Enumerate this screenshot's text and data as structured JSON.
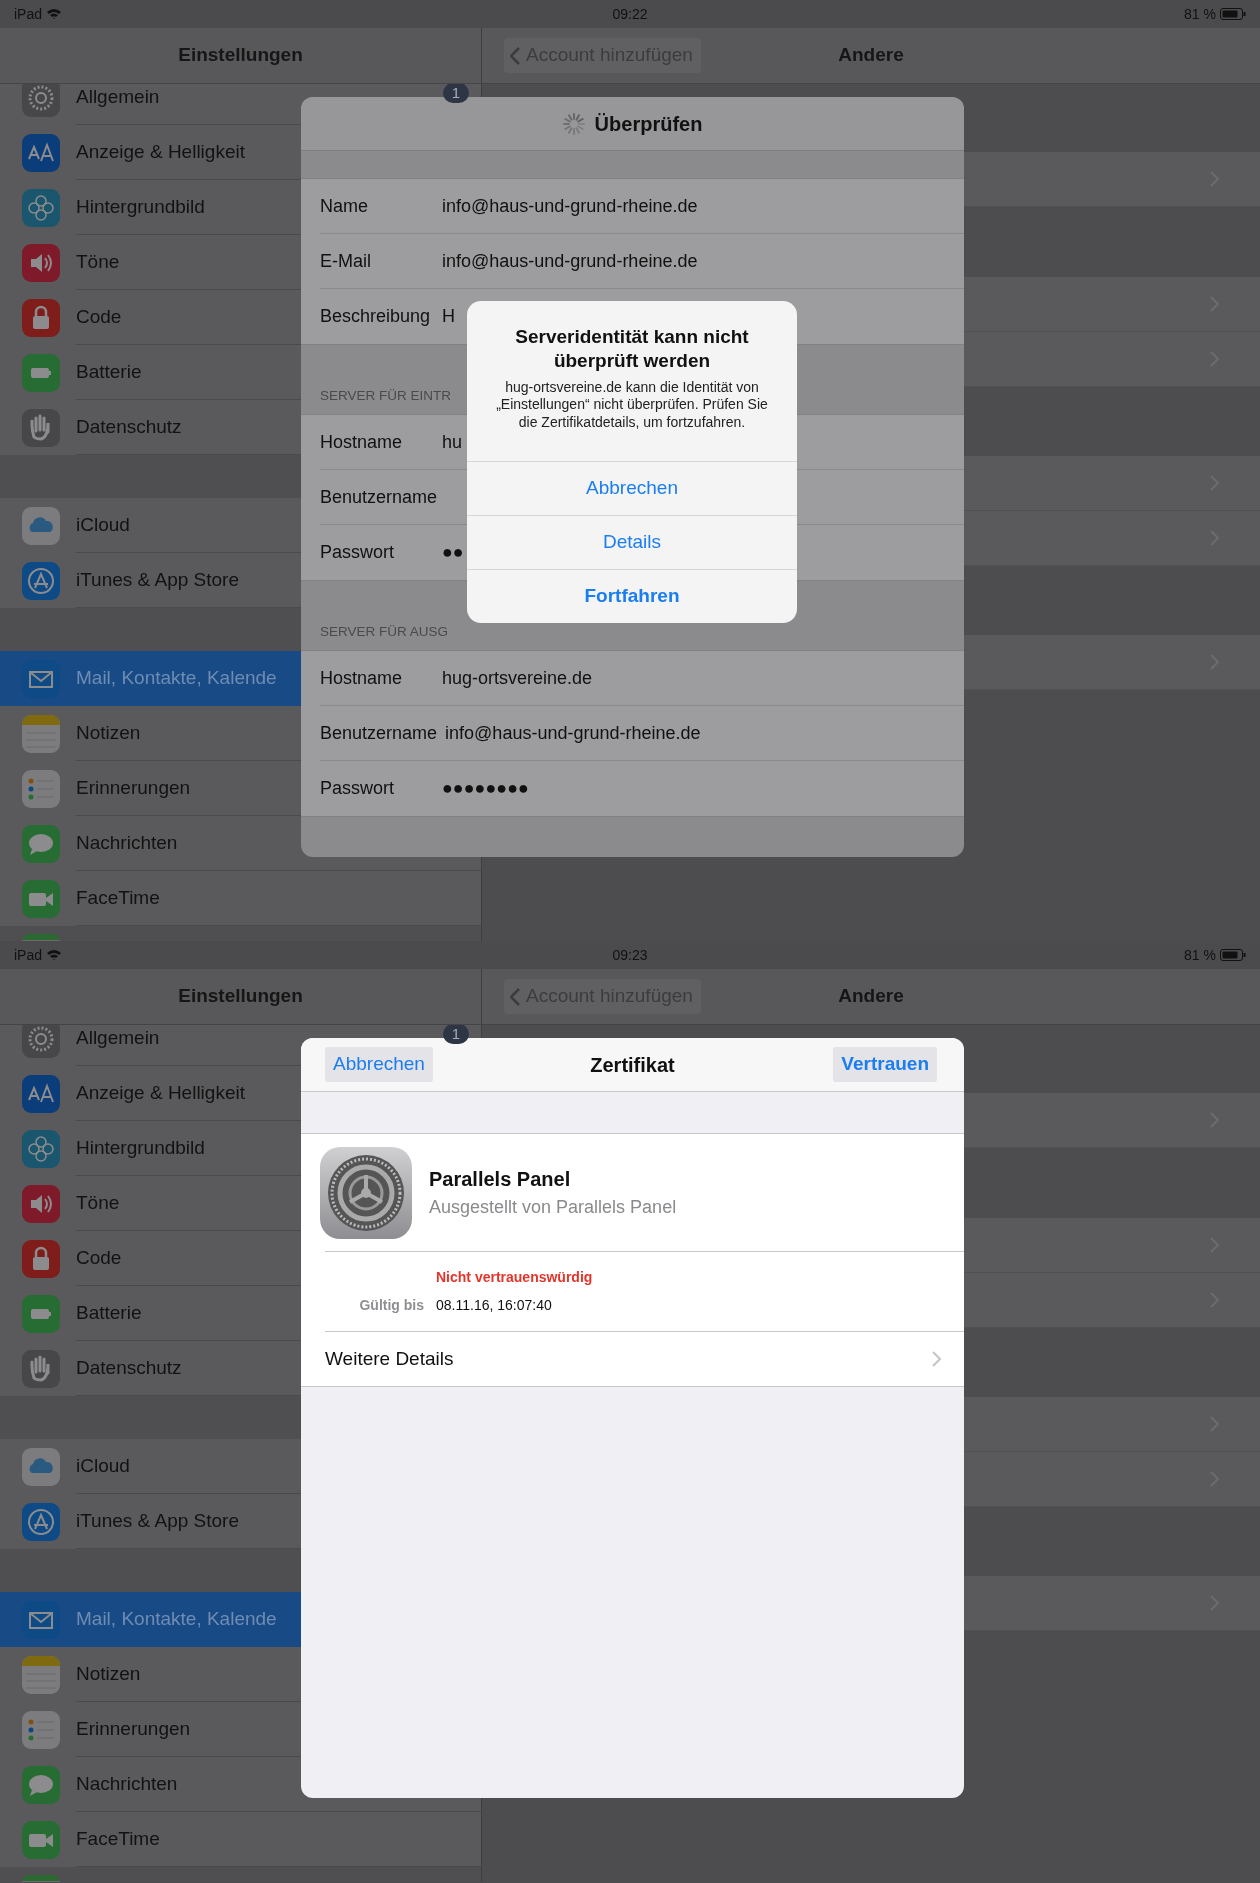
{
  "screens": [
    {
      "status_bar": {
        "carrier": "iPad",
        "time": "09:22",
        "battery": "81 %"
      },
      "nav": {
        "sidebar_title": "Einstellungen",
        "back": "Account hinzufügen",
        "title": "Andere"
      },
      "sidebar": {
        "groups": [
          [
            {
              "label": "Allgemein",
              "color": "#474749",
              "selected": false,
              "badge": "1"
            },
            {
              "label": "Anzeige & Helligkeit",
              "color": "#0a3d7a",
              "selected": false
            },
            {
              "label": "Hintergrundbild",
              "color": "#1a566e",
              "selected": false
            },
            {
              "label": "Töne",
              "color": "#7f1a2b",
              "selected": false
            },
            {
              "label": "Code",
              "color": "#7f1d1a",
              "selected": false
            },
            {
              "label": "Batterie",
              "color": "#266c33",
              "selected": false
            },
            {
              "label": "Datenschutz",
              "color": "#474749",
              "selected": false
            }
          ],
          [
            {
              "label": "iCloud",
              "color": "#7c7c7e",
              "selected": false
            },
            {
              "label": "iTunes & App Store",
              "color": "#0e4a86",
              "selected": false
            }
          ],
          [
            {
              "label": "Mail, Kontakte, Kalende",
              "color": "#0e4a86",
              "selected": true
            },
            {
              "label": "Notizen",
              "color": "#7c7c7e",
              "selected": false
            },
            {
              "label": "Erinnerungen",
              "color": "#7c7c7e",
              "selected": false
            },
            {
              "label": "Nachrichten",
              "color": "#266c33",
              "selected": false
            },
            {
              "label": "FaceTime",
              "color": "#266c33",
              "selected": false
            }
          ]
        ]
      },
      "modal": {
        "kind": "account",
        "title": "Überprüfen",
        "sections": [
          {
            "rows": [
              {
                "label": "Name",
                "value": "info@haus-und-grund-rheine.de"
              },
              {
                "label": "E-Mail",
                "value": "info@haus-und-grund-rheine.de"
              },
              {
                "label": "Beschreibung",
                "value": "H"
              }
            ]
          },
          {
            "header": "SERVER FÜR EINTR",
            "rows": [
              {
                "label": "Hostname",
                "value": "hu"
              },
              {
                "label": "Benutzername"
              },
              {
                "label": "Passwort",
                "value": "●●"
              }
            ]
          },
          {
            "header": "SERVER FÜR AUSG",
            "rows": [
              {
                "label": "Hostname",
                "value": "hug-ortsvereine.de"
              },
              {
                "label": "Benutzername",
                "value": "info@haus-und-grund-rheine.de"
              },
              {
                "label": "Passwort",
                "value": "●●●●●●●●"
              }
            ]
          }
        ]
      },
      "alert": {
        "title": "Serveridentität kann nicht überprüft werden",
        "message": "hug-ortsvereine.de kann die Identität von „Einstellungen“ nicht überprüfen. Prüfen Sie die Zertifikatdetails, um fortzufahren.",
        "buttons": [
          {
            "label": "Abbrechen",
            "emphasized": false
          },
          {
            "label": "Details",
            "emphasized": false
          },
          {
            "label": "Fortfahren",
            "emphasized": true
          }
        ]
      }
    },
    {
      "status_bar": {
        "carrier": "iPad",
        "time": "09:23",
        "battery": "81 %"
      },
      "nav": {
        "sidebar_title": "Einstellungen",
        "back": "Account hinzufügen",
        "title": "Andere"
      },
      "sidebar": {
        "groups": [
          [
            {
              "label": "Allgemein",
              "color": "#474749",
              "selected": false,
              "badge": "1"
            },
            {
              "label": "Anzeige & Helligkeit",
              "color": "#0a3d7a",
              "selected": false
            },
            {
              "label": "Hintergrundbild",
              "color": "#1a566e",
              "selected": false
            },
            {
              "label": "Töne",
              "color": "#7f1a2b",
              "selected": false
            },
            {
              "label": "Code",
              "color": "#7f1d1a",
              "selected": false
            },
            {
              "label": "Batterie",
              "color": "#266c33",
              "selected": false
            },
            {
              "label": "Datenschutz",
              "color": "#474749",
              "selected": false
            }
          ],
          [
            {
              "label": "iCloud",
              "color": "#7c7c7e",
              "selected": false
            },
            {
              "label": "iTunes & App Store",
              "color": "#0e4a86",
              "selected": false
            }
          ],
          [
            {
              "label": "Mail, Kontakte, Kalende",
              "color": "#0e4a86",
              "selected": true
            },
            {
              "label": "Notizen",
              "color": "#7c7c7e",
              "selected": false
            },
            {
              "label": "Erinnerungen",
              "color": "#7c7c7e",
              "selected": false
            },
            {
              "label": "Nachrichten",
              "color": "#266c33",
              "selected": false
            },
            {
              "label": "FaceTime",
              "color": "#266c33",
              "selected": false
            }
          ]
        ]
      },
      "modal": {
        "kind": "certificate",
        "cancel": "Abbrechen",
        "title": "Zertifikat",
        "confirm": "Vertrauen",
        "cert": {
          "name": "Parallels Panel",
          "issuer": "Ausgestellt von Parallels Panel"
        },
        "trust_status": "Nicht vertrauenswürdig",
        "details": [
          {
            "label": "Gültig bis",
            "value": "08.11.16, 16:07:40"
          }
        ],
        "more": "Weitere Details"
      }
    }
  ]
}
